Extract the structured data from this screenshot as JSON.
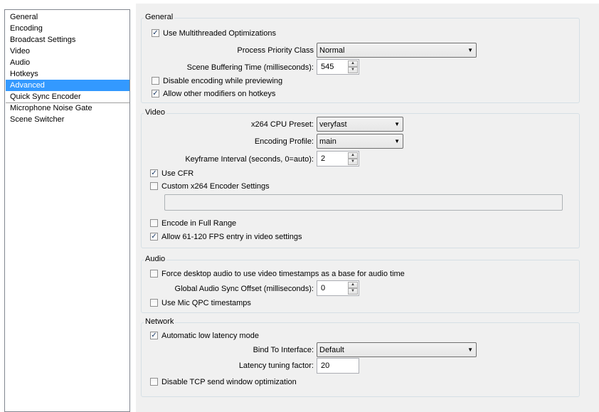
{
  "nav": {
    "items": [
      {
        "label": "General"
      },
      {
        "label": "Encoding"
      },
      {
        "label": "Broadcast Settings"
      },
      {
        "label": "Video"
      },
      {
        "label": "Audio"
      },
      {
        "label": "Hotkeys"
      },
      {
        "label": "Advanced"
      },
      {
        "label": "Quick Sync Encoder"
      },
      {
        "label": "Microphone Noise Gate"
      },
      {
        "label": "Scene Switcher"
      }
    ],
    "selected": "Advanced"
  },
  "general": {
    "title": "General",
    "multithreaded": {
      "label": "Use Multithreaded Optimizations",
      "checked": true
    },
    "priority": {
      "label": "Process Priority Class",
      "value": "Normal"
    },
    "buffering": {
      "label": "Scene Buffering Time (milliseconds):",
      "value": "545"
    },
    "disable_preview": {
      "label": "Disable encoding while previewing",
      "checked": false
    },
    "modifiers": {
      "label": "Allow other modifiers on hotkeys",
      "checked": true
    }
  },
  "video": {
    "title": "Video",
    "preset": {
      "label": "x264 CPU Preset:",
      "value": "veryfast"
    },
    "profile": {
      "label": "Encoding Profile:",
      "value": "main"
    },
    "keyframe": {
      "label": "Keyframe Interval (seconds, 0=auto):",
      "value": "2"
    },
    "cfr": {
      "label": "Use CFR",
      "checked": true
    },
    "custom": {
      "label": "Custom x264 Encoder Settings",
      "checked": false,
      "value": ""
    },
    "full_range": {
      "label": "Encode in Full Range",
      "checked": false
    },
    "fps": {
      "label": "Allow 61-120 FPS entry in video settings",
      "checked": true
    }
  },
  "audio": {
    "title": "Audio",
    "force_desktop": {
      "label": "Force desktop audio to use video timestamps as a base for audio time",
      "checked": false
    },
    "sync_offset": {
      "label": "Global Audio Sync Offset (milliseconds):",
      "value": "0"
    },
    "mic_qpc": {
      "label": "Use Mic QPC timestamps",
      "checked": false
    }
  },
  "network": {
    "title": "Network",
    "low_latency": {
      "label": "Automatic low latency mode",
      "checked": true
    },
    "bind": {
      "label": "Bind To Interface:",
      "value": "Default"
    },
    "latency_factor": {
      "label": "Latency tuning factor:",
      "value": "20"
    },
    "disable_tcp": {
      "label": "Disable TCP send window optimization",
      "checked": false
    }
  },
  "icons": {
    "check": "✓",
    "combo_arrow": "▼",
    "spin_up": "▲",
    "spin_down": "▼"
  }
}
